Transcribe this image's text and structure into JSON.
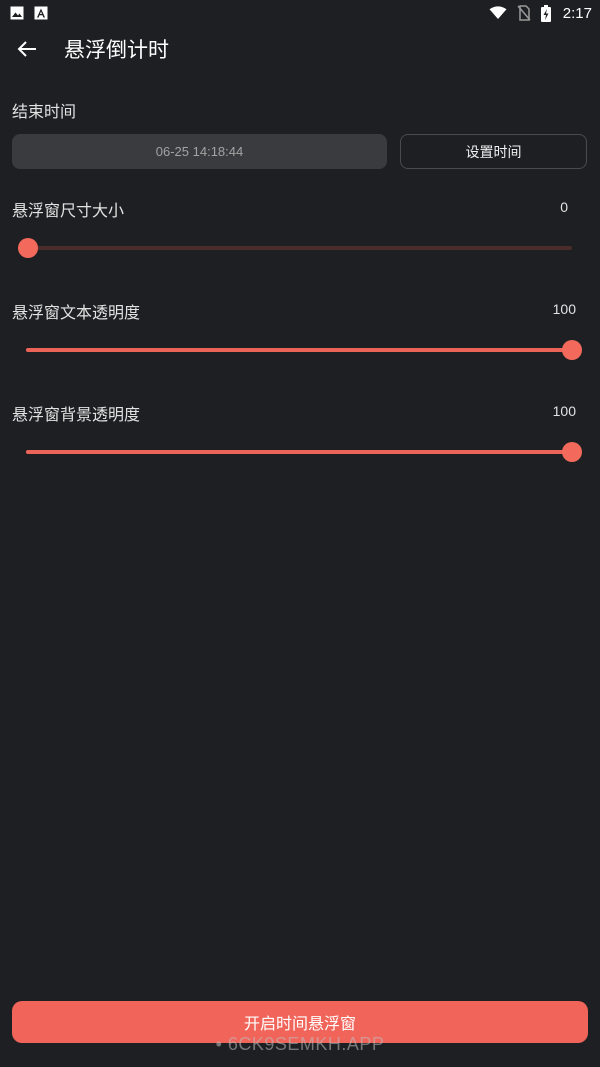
{
  "status_bar": {
    "time": "2:17",
    "icons": [
      "image-icon",
      "font-a-icon",
      "wifi-icon",
      "no-sim-icon",
      "battery-charging-icon"
    ]
  },
  "app_bar": {
    "title": "悬浮倒计时",
    "back_icon": "arrow-left-icon"
  },
  "end_time": {
    "label": "结束时间",
    "value": "06-25 14:18:44",
    "button_label": "设置时间"
  },
  "sliders": [
    {
      "label": "悬浮窗尺寸大小",
      "value_text": "0",
      "value": 0,
      "min": 0,
      "max": 100
    },
    {
      "label": "悬浮窗文本透明度",
      "value_text": "100",
      "value": 100,
      "min": 0,
      "max": 100
    },
    {
      "label": "悬浮窗背景透明度",
      "value_text": "100",
      "value": 100,
      "min": 0,
      "max": 100
    }
  ],
  "primary_button": {
    "label": "开启时间悬浮窗"
  },
  "watermark": "• 6CK9SEMKH.APP",
  "colors": {
    "background": "#1e1f22",
    "accent": "#f1645a",
    "track_inactive": "#4a2c2a",
    "field_bg": "#3a3b3f"
  }
}
